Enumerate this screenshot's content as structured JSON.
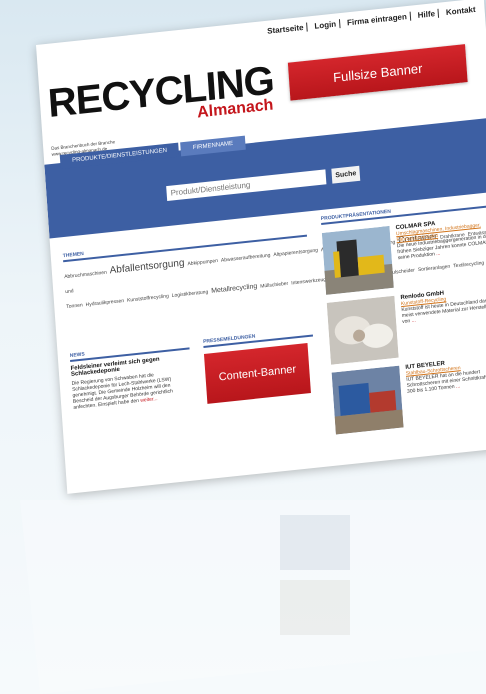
{
  "topnav": [
    "Startseite",
    "Login",
    "Firma eintragen",
    "Hilfe",
    "Kontakt"
  ],
  "logo": {
    "title": "RECYCLING",
    "subtitle": "Almanach",
    "tagline": "Das Branchenbuch der Branche www.recycling-almanach.de"
  },
  "fullsize_banner": "Fullsize Banner",
  "tabs": [
    "PRODUKTE/DIENSTLEISTUNGEN",
    "FIRMENNAME"
  ],
  "search": {
    "placeholder": "Produkt/Dienstleistung",
    "button": "Suche"
  },
  "themen": {
    "title": "THEMEN",
    "cloud": [
      "Abbruchmaschinen",
      "Abfallentsorgung",
      "Abkippumpen",
      "Abwasseraufbereitung",
      "Altpapierentsorgung",
      "Altölentsorgung",
      "Batterierecycling",
      "Container",
      "Drahtkrane",
      "Entwässer",
      "Filteranlagen",
      "Fässer und Tonnen",
      "Hydraulikpressen",
      "Kunststoffrecycling",
      "Logistikberatung",
      "Metallrecycling",
      "Müllschieber",
      "Intenswerkzeuge",
      "Recycling",
      "Schrottpulscheider",
      "Sortieranlagen",
      "Textilrecycling",
      "Zerkleinerer"
    ]
  },
  "news": {
    "title": "NEWS",
    "headline": "Feldsleiner verleimt sich gegen Schlackedeponie",
    "text": "Die Regierung von Schwaben hat die Schlackedeponie für Lech-Stahlwerke (LSW) genehmigt. Die Gemeinde Holzheim will den Bescheid der Augsburger Behörde gerichtlich anfechten. Einspielt habe den",
    "more": "weiter..."
  },
  "presse": {
    "title": "PRESSEMELDUNGEN",
    "banner": "Content-Banner"
  },
  "produkte": {
    "title": "PRODUKTPRÄSENTATIONEN",
    "items": [
      {
        "name": "COLMAR SPA",
        "link": "Umschlagmaschinen, Industriebagger, Fahrzeugspezialist",
        "text": "Die neue Industriebaggergeneration in der frühen Siebziger Jahren konnte COLMAR seine Produktion",
        "more": "..."
      },
      {
        "name": "Renlodo GmbH",
        "link": "Kunststoff-Recycling",
        "text": "Kunststoff ist heute in Deutschland das meist verwendete Material zur Herstellung von",
        "more": "..."
      },
      {
        "name": "IUT BEYELER",
        "link": "Stahlbau-Schrottscheren",
        "text": "IUT BEYELER hat an die hundert Schrottscheren mit einer Schnittkraft von 300 bis 1.100 Tonnen",
        "more": "..."
      }
    ]
  }
}
